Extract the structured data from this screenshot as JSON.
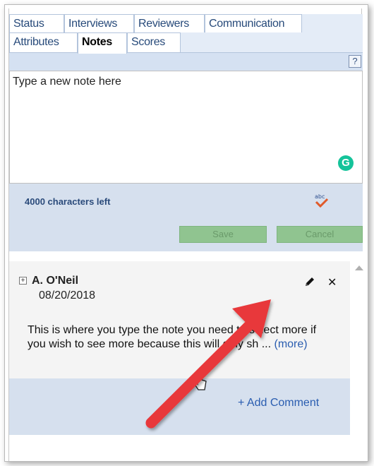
{
  "tabs": {
    "row1": [
      {
        "label": "Status"
      },
      {
        "label": "Interviews"
      },
      {
        "label": "Reviewers"
      },
      {
        "label": "Communication"
      }
    ],
    "row2": [
      {
        "label": "Attributes"
      },
      {
        "label": "Notes",
        "active": true
      },
      {
        "label": "Scores"
      }
    ]
  },
  "help": {
    "label": "?"
  },
  "note_editor": {
    "placeholder": "Type a new note here",
    "chars_left": "4000 characters left",
    "grammarly_label": "G",
    "save_label": "Save",
    "cancel_label": "Cancel"
  },
  "notes": [
    {
      "author": "A. O'Neil",
      "date": "08/20/2018",
      "body": "This is where you type the note you need to select more if you wish to see more because this will only sh ...",
      "more_label": "(more)",
      "add_comment_label": "+ Add Comment"
    }
  ],
  "colors": {
    "tab_bg": "#e4ecf7",
    "panel_blue": "#d6e0ee",
    "button_green": "#90c490",
    "link_blue": "#2a5db0",
    "arrow_red": "#e8383a"
  }
}
